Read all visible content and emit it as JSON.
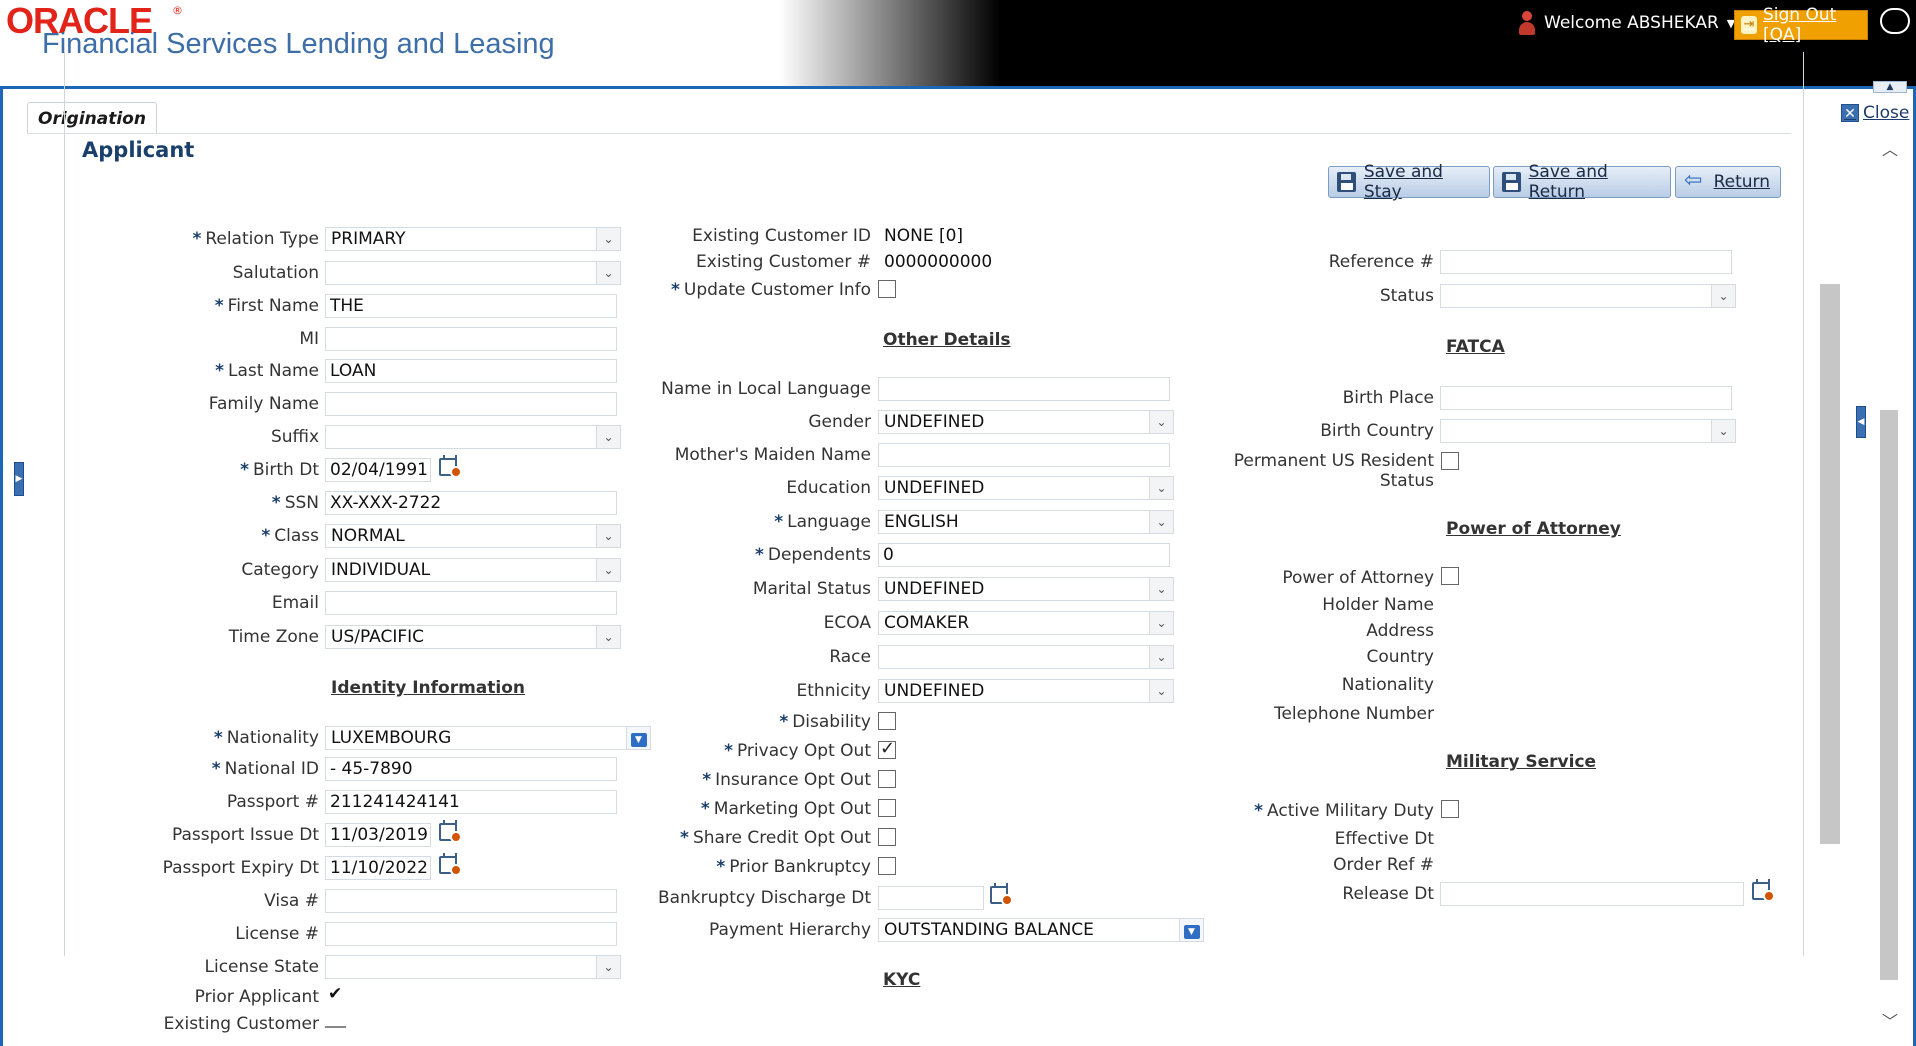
{
  "header": {
    "brand": "ORACLE",
    "brand_mark": "®",
    "product": "Financial Services Lending and Leasing",
    "welcome": "Welcome ABSHEKAR",
    "signout": "Sign Out [QA]"
  },
  "tabs": {
    "origination": "Origination"
  },
  "close_label": "Close",
  "page_title": "Applicant",
  "toolbar": {
    "save_stay": "Save and Stay",
    "save_return": "Save and Return",
    "return": "Return"
  },
  "col1": {
    "relation_type": {
      "label": "Relation Type",
      "value": "PRIMARY"
    },
    "salutation": {
      "label": "Salutation",
      "value": ""
    },
    "first_name": {
      "label": "First Name",
      "value": "THE"
    },
    "mi": {
      "label": "MI",
      "value": ""
    },
    "last_name": {
      "label": "Last Name",
      "value": "LOAN"
    },
    "family_name": {
      "label": "Family Name",
      "value": ""
    },
    "suffix": {
      "label": "Suffix",
      "value": ""
    },
    "birth_dt": {
      "label": "Birth Dt",
      "value": "02/04/1991"
    },
    "ssn": {
      "label": "SSN",
      "value": "XX-XXX-2722"
    },
    "class": {
      "label": "Class",
      "value": "NORMAL"
    },
    "category": {
      "label": "Category",
      "value": "INDIVIDUAL"
    },
    "email": {
      "label": "Email",
      "value": ""
    },
    "time_zone": {
      "label": "Time Zone",
      "value": "US/PACIFIC"
    },
    "identity_heading": "Identity Information",
    "nationality": {
      "label": "Nationality",
      "value": "LUXEMBOURG"
    },
    "national_id": {
      "label": "National ID",
      "value": "- 45-7890"
    },
    "passport": {
      "label": "Passport #",
      "value": "211241424141"
    },
    "passport_issue": {
      "label": "Passport Issue Dt",
      "value": "11/03/2019"
    },
    "passport_expiry": {
      "label": "Passport Expiry Dt",
      "value": "11/10/2022"
    },
    "visa": {
      "label": "Visa #",
      "value": ""
    },
    "license": {
      "label": "License #",
      "value": ""
    },
    "license_state": {
      "label": "License State",
      "value": ""
    },
    "prior_applicant": {
      "label": "Prior Applicant",
      "value": "✔"
    },
    "existing_customer": {
      "label": "Existing Customer",
      "value": "___"
    }
  },
  "col2": {
    "existing_customer_id": {
      "label": "Existing Customer ID",
      "value": "NONE [0]"
    },
    "existing_customer_no": {
      "label": "Existing Customer #",
      "value": "0000000000"
    },
    "update_customer_info": {
      "label": "Update Customer Info"
    },
    "other_heading": "Other Details",
    "name_local": {
      "label": "Name in Local Language",
      "value": ""
    },
    "gender": {
      "label": "Gender",
      "value": "UNDEFINED"
    },
    "mothers_maiden": {
      "label": "Mother's Maiden Name",
      "value": ""
    },
    "education": {
      "label": "Education",
      "value": "UNDEFINED"
    },
    "language": {
      "label": "Language",
      "value": "ENGLISH"
    },
    "dependents": {
      "label": "Dependents",
      "value": "0"
    },
    "marital_status": {
      "label": "Marital Status",
      "value": "UNDEFINED"
    },
    "ecoa": {
      "label": "ECOA",
      "value": "COMAKER"
    },
    "race": {
      "label": "Race",
      "value": ""
    },
    "ethnicity": {
      "label": "Ethnicity",
      "value": "UNDEFINED"
    },
    "disability": {
      "label": "Disability",
      "checked": false
    },
    "privacy_opt_out": {
      "label": "Privacy Opt Out",
      "checked": true
    },
    "insurance_opt_out": {
      "label": "Insurance Opt Out",
      "checked": false
    },
    "marketing_opt_out": {
      "label": "Marketing Opt Out",
      "checked": false
    },
    "share_credit_opt_out": {
      "label": "Share Credit Opt Out",
      "checked": false
    },
    "prior_bankruptcy": {
      "label": "Prior Bankruptcy",
      "checked": false
    },
    "bankruptcy_discharge": {
      "label": "Bankruptcy Discharge Dt",
      "value": ""
    },
    "payment_hierarchy": {
      "label": "Payment Hierarchy",
      "value": "OUTSTANDING BALANCE"
    },
    "kyc_heading": "KYC"
  },
  "col3": {
    "reference": {
      "label": "Reference #",
      "value": ""
    },
    "status": {
      "label": "Status",
      "value": ""
    },
    "fatca_heading": "FATCA",
    "birth_place": {
      "label": "Birth Place",
      "value": ""
    },
    "birth_country": {
      "label": "Birth Country",
      "value": ""
    },
    "perm_us_resident_1": "Permanent US Resident",
    "perm_us_resident_2": "Status",
    "poa_heading": "Power of Attorney",
    "power_of_attorney": {
      "label": "Power of Attorney"
    },
    "holder_name": {
      "label": "Holder Name"
    },
    "address": {
      "label": "Address"
    },
    "country": {
      "label": "Country"
    },
    "nationality": {
      "label": "Nationality"
    },
    "telephone": {
      "label": "Telephone Number"
    },
    "military_heading": "Military Service",
    "active_military": {
      "label": "Active Military Duty"
    },
    "effective_dt": {
      "label": "Effective Dt"
    },
    "order_ref": {
      "label": "Order Ref #"
    },
    "release_dt": {
      "label": "Release Dt",
      "value": ""
    }
  },
  "colors": {
    "accent": "#1d67b6",
    "signout": "#f0a000",
    "title": "#1b3f6b",
    "brand": "#e2231a"
  }
}
